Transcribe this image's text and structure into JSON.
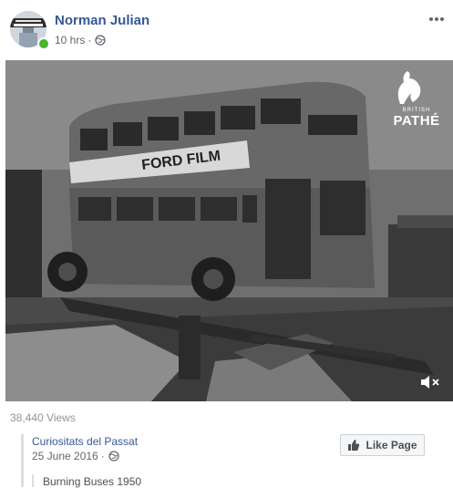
{
  "post": {
    "author": "Norman Julian",
    "timestamp": "10 hrs",
    "separator": "·",
    "privacy_icon": "globe-icon",
    "online": true
  },
  "video": {
    "watermark_small": "BRITISH",
    "watermark_brand": "PATHÉ",
    "sign_text": "FORD FILM",
    "audio_icon": "speaker-muted-icon"
  },
  "stats": {
    "views": "38,440 Views"
  },
  "shared": {
    "page_name": "Curiositats del Passat",
    "date": "25 June 2016",
    "separator": "·",
    "like_button": "Like Page",
    "caption": "Burning Buses 1950"
  },
  "colors": {
    "link": "#365899",
    "online": "#42b72a",
    "muted_text": "#616770"
  }
}
